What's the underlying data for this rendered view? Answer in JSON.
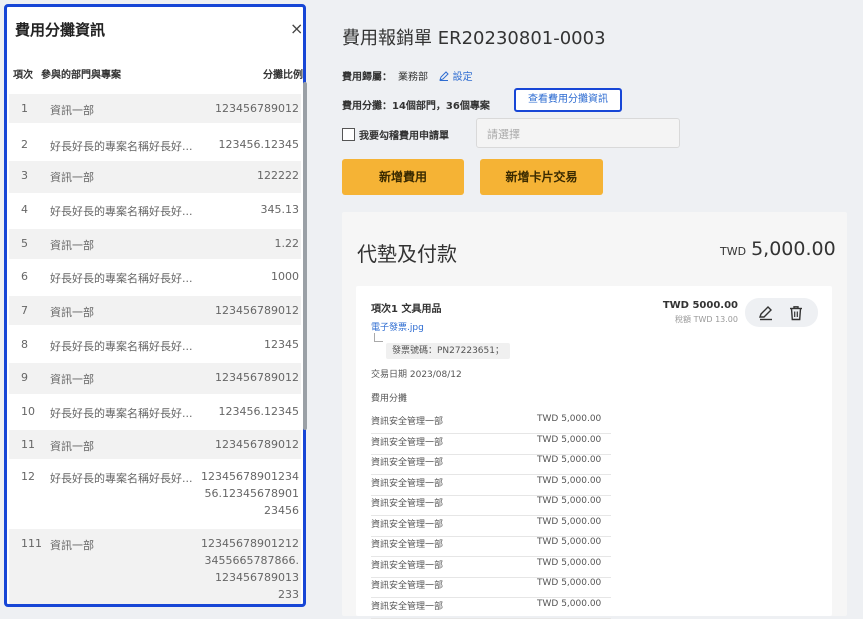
{
  "panel": {
    "title": "費用分攤資訊",
    "close_icon": "×",
    "headers": {
      "index": "項次",
      "dept": "參與的部門與專案",
      "ratio": "分攤比例"
    },
    "rows": [
      {
        "index": "1",
        "name": "資訊一部",
        "value": "123456789012"
      },
      {
        "index": "2",
        "name": "好長好長的專案名稱好長好...",
        "value": "123456.12345"
      },
      {
        "index": "3",
        "name": "資訊一部",
        "value": "122222"
      },
      {
        "index": "4",
        "name": "好長好長的專案名稱好長好...",
        "value": "345.13"
      },
      {
        "index": "5",
        "name": "資訊一部",
        "value": "1.22"
      },
      {
        "index": "6",
        "name": "好長好長的專案名稱好長好...",
        "value": "1000"
      },
      {
        "index": "7",
        "name": "資訊一部",
        "value": "123456789012"
      },
      {
        "index": "8",
        "name": "好長好長的專案名稱好長好...",
        "value": "12345"
      },
      {
        "index": "9",
        "name": "資訊一部",
        "value": "123456789012"
      },
      {
        "index": "10",
        "name": "好長好長的專案名稱好長好...",
        "value": "123456.12345"
      },
      {
        "index": "11",
        "name": "資訊一部",
        "value": "123456789012"
      },
      {
        "index": "12",
        "name": "好長好長的專案名稱好長好...",
        "value": "12345678901234\n56.12345678901\n23456"
      },
      {
        "index": "111",
        "name": "資訊一部",
        "value": "12345678901212\n3455665787866.\n123456789013\n233"
      }
    ]
  },
  "document": {
    "title": "費用報銷單 ER20230801-0003",
    "owner_label": "費用歸屬：",
    "owner_value": "業務部",
    "edit_label": "設定",
    "allocation_text": "費用分攤：14個部門，36個專案",
    "view_allocation_label": "查看費用分攤資訊",
    "checkbox_label": "我要勾稽費用申請單",
    "select_placeholder": "請選擇",
    "add_expense_label": "新增費用",
    "add_card_label": "新增卡片交易"
  },
  "advance": {
    "title": "代墊及付款",
    "currency": "TWD",
    "total": "5,000.00",
    "item": {
      "title": "項次1 文具用品",
      "file": "電子發票.jpg",
      "receipt": "發票號碼：PN27223651；",
      "date": "交易日期 2023/08/12",
      "amount": "TWD 5000.00",
      "tax": "稅額 TWD 13.00",
      "split_label": "費用分攤",
      "splits": [
        {
          "dept": "資訊安全管理一部",
          "amount": "TWD 5,000.00"
        },
        {
          "dept": "資訊安全管理一部",
          "amount": "TWD 5,000.00"
        },
        {
          "dept": "資訊安全管理一部",
          "amount": "TWD 5,000.00"
        },
        {
          "dept": "資訊安全管理一部",
          "amount": "TWD 5,000.00"
        },
        {
          "dept": "資訊安全管理一部",
          "amount": "TWD 5,000.00"
        },
        {
          "dept": "資訊安全管理一部",
          "amount": "TWD 5,000.00"
        },
        {
          "dept": "資訊安全管理一部",
          "amount": "TWD 5,000.00"
        },
        {
          "dept": "資訊安全管理一部",
          "amount": "TWD 5,000.00"
        },
        {
          "dept": "資訊安全管理一部",
          "amount": "TWD 5,000.00"
        },
        {
          "dept": "資訊安全管理一部",
          "amount": "TWD 5,000.00"
        }
      ]
    }
  },
  "colors": {
    "accent": "#2e6cd1",
    "highlight_border": "#1746d6",
    "button": "#f5b335"
  }
}
